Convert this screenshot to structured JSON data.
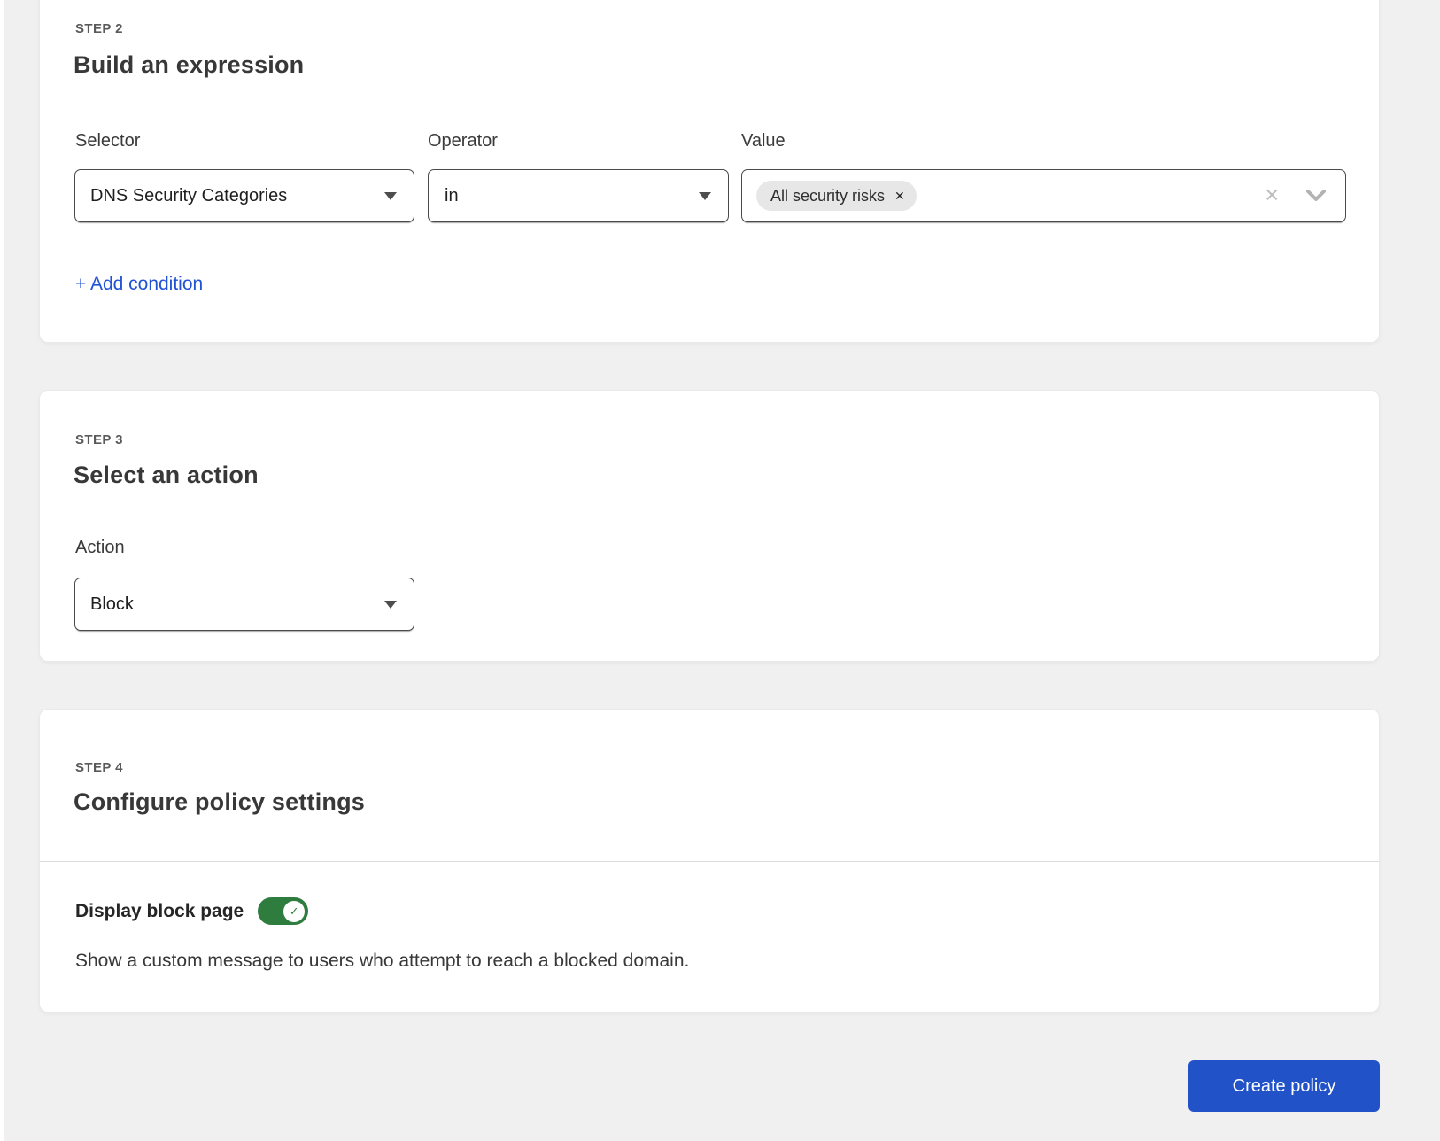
{
  "colors": {
    "page_background": "#f0f0f1",
    "card_background": "#ffffff",
    "button_blue": "#2152c8",
    "link_blue": "#2253d6",
    "toggle_green": "#2e7d3e",
    "pill_gray": "#e7e7e7"
  },
  "icons": {
    "dropdown_caret": "▾",
    "pill_remove": "✕",
    "clear_value": "✕",
    "chevron_down": "⌄",
    "toggle_check": "✓"
  },
  "step2": {
    "step_label": "STEP 2",
    "title": "Build an expression",
    "fields": {
      "selector": {
        "label": "Selector",
        "value": "DNS Security Categories"
      },
      "operator": {
        "label": "Operator",
        "value": "in"
      },
      "value": {
        "label": "Value",
        "tags": [
          {
            "label": "All security risks"
          }
        ]
      }
    },
    "add_condition_label": "+ Add condition"
  },
  "step3": {
    "step_label": "STEP 3",
    "title": "Select an action",
    "action": {
      "label": "Action",
      "value": "Block"
    }
  },
  "step4": {
    "step_label": "STEP 4",
    "title": "Configure policy settings",
    "toggle": {
      "label": "Display block page",
      "enabled": true,
      "description": "Show a custom message to users who attempt to reach a blocked domain."
    }
  },
  "footer": {
    "create_button_label": "Create policy"
  }
}
